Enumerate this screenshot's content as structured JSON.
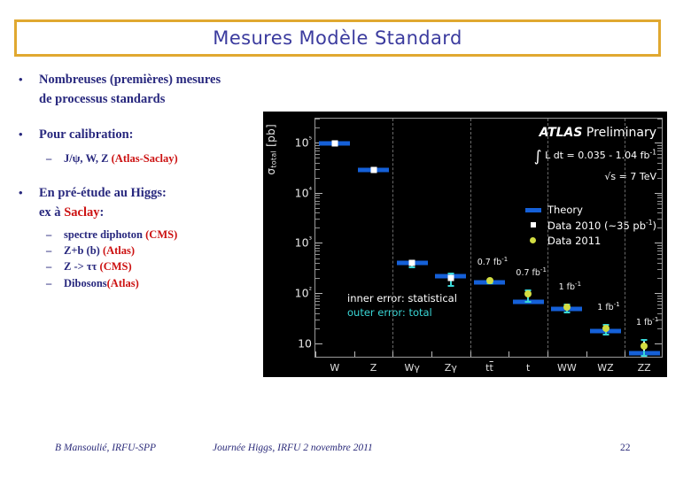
{
  "slide": {
    "title": "Mesures Modèle Standard",
    "title_border_color": "#e0a830",
    "title_color": "#3b3b9e",
    "text_color": "#28287e",
    "accent_red": "#cc1111"
  },
  "bullets": {
    "b1_line1": "Nombreuses (premières) mesures",
    "b1_line2": "de processus standards",
    "b2_line1": "Pour calibration:",
    "b2_sub1_pre": "J/ψ, W, Z ",
    "b2_sub1_red": "(Atlas-Saclay)",
    "b3_line1": "En pré-étude au Higgs:",
    "b3_line2_pre": "ex à ",
    "b3_line2_red": "Saclay",
    "b3_line2_post": ":",
    "b3_sub1_pre": "spectre diphoton ",
    "b3_sub1_red": "(CMS)",
    "b3_sub2_pre": "Z+b (b) ",
    "b3_sub2_red": "(Atlas)",
    "b3_sub3_pre": "Z -> ττ ",
    "b3_sub3_red": "(CMS)",
    "b3_sub4_pre": "Dibosons",
    "b3_sub4_red": "(Atlas)",
    "dot": "•",
    "dash": "–"
  },
  "chart_data": {
    "type": "bar",
    "title": "ATLAS Preliminary",
    "xlabel": "",
    "ylabel": "σ total [pb]",
    "ylabel_symbol": "σ",
    "ylabel_sub": "total",
    "ylabel_unit": "[pb]",
    "yscale": "log",
    "ylim": [
      5,
      300000
    ],
    "ytick_labels": [
      "10",
      "10²",
      "10³",
      "10⁴",
      "10⁵"
    ],
    "ytick_values": [
      10,
      100,
      1000,
      10000,
      100000
    ],
    "grid": "vertical-dashed",
    "legend_position": "top-right",
    "categories": [
      "W",
      "Z",
      "Wγ",
      "Zγ",
      "tt̄",
      "t",
      "WW",
      "WZ",
      "ZZ"
    ],
    "category_labels": [
      "W",
      "Z",
      "Wγ",
      "Zγ",
      "tt",
      "t",
      "WW",
      "WZ",
      "ZZ"
    ],
    "theory_values": [
      98000,
      28000,
      400,
      215,
      165,
      68,
      48,
      17.5,
      6.5
    ],
    "points": [
      {
        "category": "W",
        "value": 98000,
        "series": "Data 2010",
        "err_stat": 0,
        "err_tot": 0
      },
      {
        "category": "Z",
        "value": 29000,
        "series": "Data 2010",
        "err_stat": 0,
        "err_tot": 0
      },
      {
        "category": "Wγ",
        "value": 400,
        "series": "Data 2010",
        "err_stat": 30,
        "err_tot": 60
      },
      {
        "category": "Zγ",
        "value": 200,
        "series": "Data 2010",
        "err_stat": 25,
        "err_tot": 55
      },
      {
        "category": "tt̄",
        "value": 180,
        "series": "Data 2011",
        "err_stat": 8,
        "err_tot": 16
      },
      {
        "category": "t",
        "value": 95,
        "series": "Data 2011",
        "err_stat": 12,
        "err_tot": 24
      },
      {
        "category": "WW",
        "value": 52,
        "series": "Data 2011",
        "err_stat": 5,
        "err_tot": 9
      },
      {
        "category": "WZ",
        "value": 20,
        "series": "Data 2011",
        "err_stat": 2.5,
        "err_tot": 4.5
      },
      {
        "category": "ZZ",
        "value": 9,
        "series": "Data 2011",
        "err_stat": 1.8,
        "err_tot": 3.2
      }
    ],
    "series": [
      {
        "name": "Theory",
        "color": "#1560d8",
        "marker": "band"
      },
      {
        "name": "Data 2010",
        "color": "#ffffff",
        "marker": "square"
      },
      {
        "name": "Data 2011",
        "color": "#d2dd42",
        "marker": "circle"
      }
    ],
    "annotations": {
      "atlas_bold": "ATLAS",
      "atlas_rest": " Preliminary",
      "integral_symbol": "∫",
      "lumi_text": " L dt = 0.035 - 1.04 fb",
      "lumi_sup": "-1",
      "sqrts_text": "√s = 7 TeV",
      "inner_error": "inner error: statistical",
      "outer_error": "outer error: total",
      "lumi_notes": [
        {
          "category": "tt̄",
          "text": "0.7 fb",
          "sup": "-1"
        },
        {
          "category": "t",
          "text": "0.7 fb",
          "sup": "-1"
        },
        {
          "category": "WW",
          "text": "1 fb",
          "sup": "-1"
        },
        {
          "category": "WZ",
          "text": "1 fb",
          "sup": "-1"
        },
        {
          "category": "ZZ",
          "text": "1 fb",
          "sup": "-1"
        }
      ]
    },
    "legend_entries": [
      {
        "label": "Theory",
        "key": "theory-band"
      },
      {
        "label": "Data 2010  (~35 pb",
        "sup": "-1",
        "label_suffix": ")",
        "key": "white-square"
      },
      {
        "label": "Data 2011",
        "key": "yellow-circle"
      }
    ]
  },
  "footer": {
    "author": "B Mansoulié, IRFU-SPP",
    "event": "Journée Higgs, IRFU  2 novembre 2011",
    "page": "22"
  }
}
